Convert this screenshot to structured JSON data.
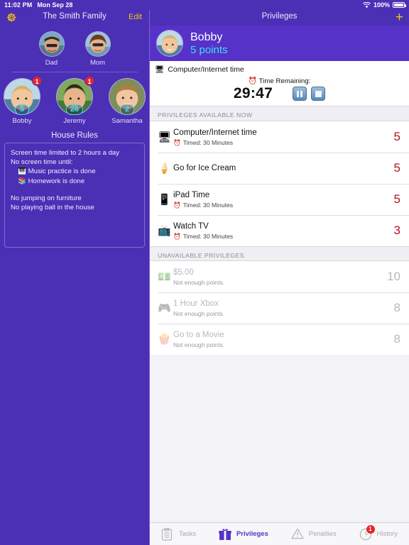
{
  "status_bar": {
    "time": "11:02 PM",
    "date": "Mon Sep 28",
    "wifi_icon": "wifi-icon",
    "battery_percent": "100%"
  },
  "sidebar": {
    "gear_icon": "gear-icon",
    "title": "The Smith Family",
    "edit_label": "Edit",
    "parents": [
      {
        "name": "Dad",
        "avatar": "dad-avatar"
      },
      {
        "name": "Mom",
        "avatar": "mom-avatar"
      }
    ],
    "children": [
      {
        "name": "Bobby",
        "points": "5",
        "badge": "1",
        "avatar": "bobby-avatar"
      },
      {
        "name": "Jeremy",
        "points": "28",
        "badge": "1",
        "avatar": "jeremy-avatar"
      },
      {
        "name": "Samantha",
        "points": "2",
        "badge": "",
        "avatar": "samantha-avatar"
      }
    ],
    "house_rules": {
      "title": "House Rules",
      "lines": [
        {
          "text": "Screen time limited to 2 hours a day",
          "icon": "",
          "indent": false
        },
        {
          "text": "No screen time until:",
          "icon": "",
          "indent": false
        },
        {
          "text": "Music practice is done",
          "icon": "🎹",
          "indent": true
        },
        {
          "text": "Homework is done",
          "icon": "📚",
          "indent": true
        },
        {
          "text": "",
          "icon": "",
          "indent": false
        },
        {
          "text": "No jumping on furniture",
          "icon": "",
          "indent": false
        },
        {
          "text": "No playing ball in the house",
          "icon": "",
          "indent": false
        }
      ]
    }
  },
  "panel": {
    "title": "Privileges",
    "add_icon": "plus-icon",
    "user": {
      "name": "Bobby",
      "points": "5 points",
      "avatar": "bobby-avatar"
    },
    "timer": {
      "icon": "🖥",
      "title": "Computer/Internet time",
      "remaining_icon": "⏰",
      "remaining_label": "Time Remaining:",
      "digits": "29:47",
      "pause_icon": "pause-icon",
      "stop_icon": "stop-icon"
    },
    "sections": [
      {
        "header": "PRIVILEGES AVAILABLE NOW",
        "dim": false,
        "items": [
          {
            "icon": "🖥",
            "label": "Computer/Internet time",
            "sub_icon": "⏰",
            "sub": "Timed: 30 Minutes",
            "value": "5"
          },
          {
            "icon": "🍦",
            "label": "Go for Ice Cream",
            "sub_icon": "",
            "sub": "",
            "value": "5"
          },
          {
            "icon": "📱",
            "label": "iPad Time",
            "sub_icon": "⏰",
            "sub": "Timed: 30 Minutes",
            "value": "5"
          },
          {
            "icon": "📺",
            "label": "Watch TV",
            "sub_icon": "⏰",
            "sub": "Timed: 30 Minutes",
            "value": "3"
          }
        ]
      },
      {
        "header": "UNAVAILABLE PRIVILEGES",
        "dim": true,
        "items": [
          {
            "icon": "💵",
            "label": "$5.00",
            "sub_icon": "",
            "sub": "Not enough points.",
            "value": "10"
          },
          {
            "icon": "🎮",
            "label": "1 Hour Xbox",
            "sub_icon": "",
            "sub": "Not enough points.",
            "value": "8"
          },
          {
            "icon": "🍿",
            "label": "Go to a Movie",
            "sub_icon": "",
            "sub": "Not enough points.",
            "value": "8"
          }
        ]
      }
    ]
  },
  "tabbar": {
    "tabs": [
      {
        "label": "Tasks",
        "icon": "clipboard-icon",
        "active": false,
        "badge": ""
      },
      {
        "label": "Privileges",
        "icon": "gift-icon",
        "active": true,
        "badge": ""
      },
      {
        "label": "Penalties",
        "icon": "warning-triangle-icon",
        "active": false,
        "badge": ""
      },
      {
        "label": "History",
        "icon": "clock-icon",
        "active": false,
        "badge": "1"
      }
    ]
  },
  "colors": {
    "purple": "#4b2fb5",
    "purple_header": "#5632c8",
    "accent_yellow": "#f0c419",
    "cyan": "#3ce0f0",
    "red_value": "#b3121d",
    "badge_red": "#e8222a"
  }
}
